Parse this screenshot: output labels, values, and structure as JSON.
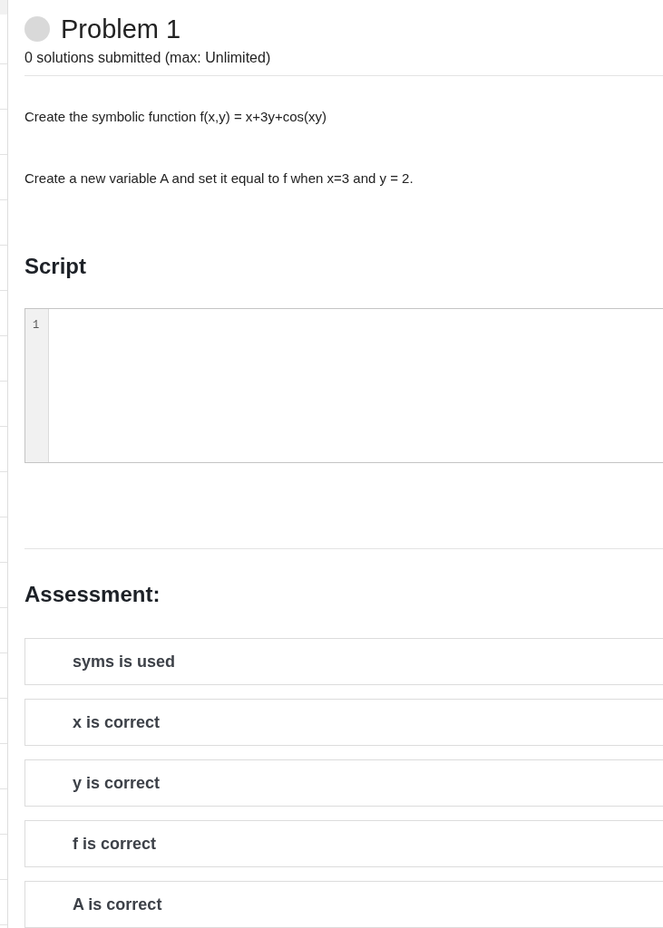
{
  "problem": {
    "title": "Problem 1",
    "solved": false,
    "submissions": "0 solutions submitted (max: Unlimited)"
  },
  "description": [
    "Create the symbolic function f(x,y) = x+3y+cos(xy)",
    "Create a new variable A and set it equal to f when x=3 and y = 2."
  ],
  "script": {
    "heading": "Script",
    "line_numbers": [
      "1"
    ]
  },
  "assessment": {
    "heading": "Assessment:",
    "tests": [
      "syms is used",
      "x is correct",
      "y is correct",
      "f is correct",
      "A is correct"
    ]
  }
}
